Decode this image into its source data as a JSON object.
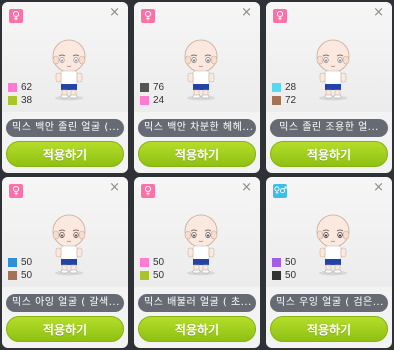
{
  "cards": [
    {
      "gender": "♀",
      "gender_type": "female",
      "colors": [
        {
          "color": "#ff7ad0",
          "value": "62"
        },
        {
          "color": "#a8c52a",
          "value": "38"
        }
      ],
      "name": "믹스 백안 졸린 얼굴 (...",
      "apply": "적용하기",
      "close": "×",
      "eye": "#9a9a9a"
    },
    {
      "gender": "♀",
      "gender_type": "female",
      "colors": [
        {
          "color": "#555555",
          "value": "76"
        },
        {
          "color": "#ff7ad0",
          "value": "24"
        }
      ],
      "name": "믹스 백안 차분한 헤헤...",
      "apply": "적용하기",
      "close": "×",
      "eye": "#7a7a7a"
    },
    {
      "gender": "♀",
      "gender_type": "female",
      "colors": [
        {
          "color": "#55d8f0",
          "value": "28"
        },
        {
          "color": "#a47255",
          "value": "72"
        }
      ],
      "name": "믹스 졸린 조용한 얼...",
      "apply": "적용하기",
      "close": "×",
      "eye": "#8a8a8a"
    },
    {
      "gender": "♀",
      "gender_type": "female",
      "colors": [
        {
          "color": "#2c8fd8",
          "value": "50"
        },
        {
          "color": "#a47255",
          "value": "50"
        }
      ],
      "name": "믹스 아잉 얼굴 ( 갈색...",
      "apply": "적용하기",
      "close": "×",
      "eye": "#6a4a3a"
    },
    {
      "gender": "♀",
      "gender_type": "female",
      "colors": [
        {
          "color": "#ff7ad0",
          "value": "50"
        },
        {
          "color": "#a8c52a",
          "value": "50"
        }
      ],
      "name": "믹스 배불러 얼굴 ( 초...",
      "apply": "적용하기",
      "close": "×",
      "eye": "#555555"
    },
    {
      "gender": "♀♂",
      "gender_type": "mixed",
      "colors": [
        {
          "color": "#a35de8",
          "value": "50"
        },
        {
          "color": "#333333",
          "value": "50"
        }
      ],
      "name": "믹스 우잉 얼굴 ( 검은...",
      "apply": "적용하기",
      "close": "×",
      "eye": "#333333"
    }
  ]
}
